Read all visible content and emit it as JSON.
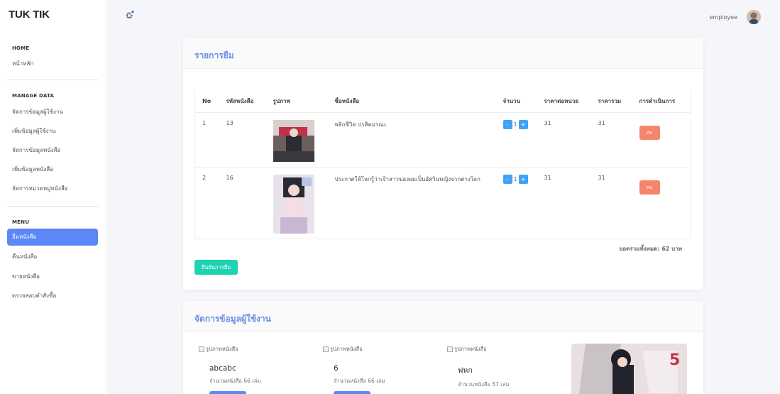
{
  "brand": "TUK TIK",
  "sidebar": {
    "sections": [
      {
        "title": "HOME",
        "items": [
          "หน้าหลัก"
        ]
      },
      {
        "title": "MANAGE DATA",
        "items": [
          "จัดการข้อมูลผู้ใช้งาน",
          "เพิ่มข้อมูลผู้ใช้งาน",
          "จัดการข้อมูลหนังสือ",
          "เพิ่มข้อมูลหนังสือ",
          "จัดการหมวดหมู่หนังสือ"
        ]
      },
      {
        "title": "MENU",
        "items": [
          "ยืมหนังสือ",
          "คืนหนังสือ",
          "ขายหนังสือ",
          "ตรวจสอบคำสั่งซื้อ"
        ]
      }
    ],
    "active_item": "ยืมหนังสือ"
  },
  "topbar": {
    "user": "employee",
    "icon": "gear-icon"
  },
  "borrow": {
    "title": "รายการยืม",
    "columns": [
      "No",
      "รหัสหนังสือ",
      "รูปภาพ",
      "ชื่อหนังสือ",
      "จำนวน",
      "ราคาต่อหน่วย",
      "ราคารวม",
      "การดำเนินการ"
    ],
    "rows": [
      {
        "no": "1",
        "code": "13",
        "name": "พลิกชีวิต ปรสิตมรณะ",
        "qty": "1",
        "unit_price": "31",
        "total": "31",
        "delete": "ลบ"
      },
      {
        "no": "2",
        "code": "16",
        "name": "ประกาศให้โลกรู้ว่าเจ้าสาวของผมเป็นอัศวินหญิงจากต่างโลก",
        "qty": "1",
        "unit_price": "31",
        "total": "31",
        "delete": "ลบ"
      }
    ],
    "minus": "-",
    "plus": "+",
    "grand_total": "ยอดรวมทั้งหมด: 62 บาท",
    "confirm": "ยืนยันการยืม"
  },
  "books_section": {
    "title": "จัดการข้อมูลผู้ใช้งาน",
    "img_alt": "รูปภาพหนังสือ",
    "books": [
      {
        "name": "abcabc",
        "count": "จำนวนหนังสือ 66 เล่ม"
      },
      {
        "name": "6",
        "count": "จำนวนหนังสือ 66 เล่ม"
      },
      {
        "name": "ฟหก",
        "count": "จำนวนหนังสือ 57 เล่ม"
      }
    ]
  }
}
